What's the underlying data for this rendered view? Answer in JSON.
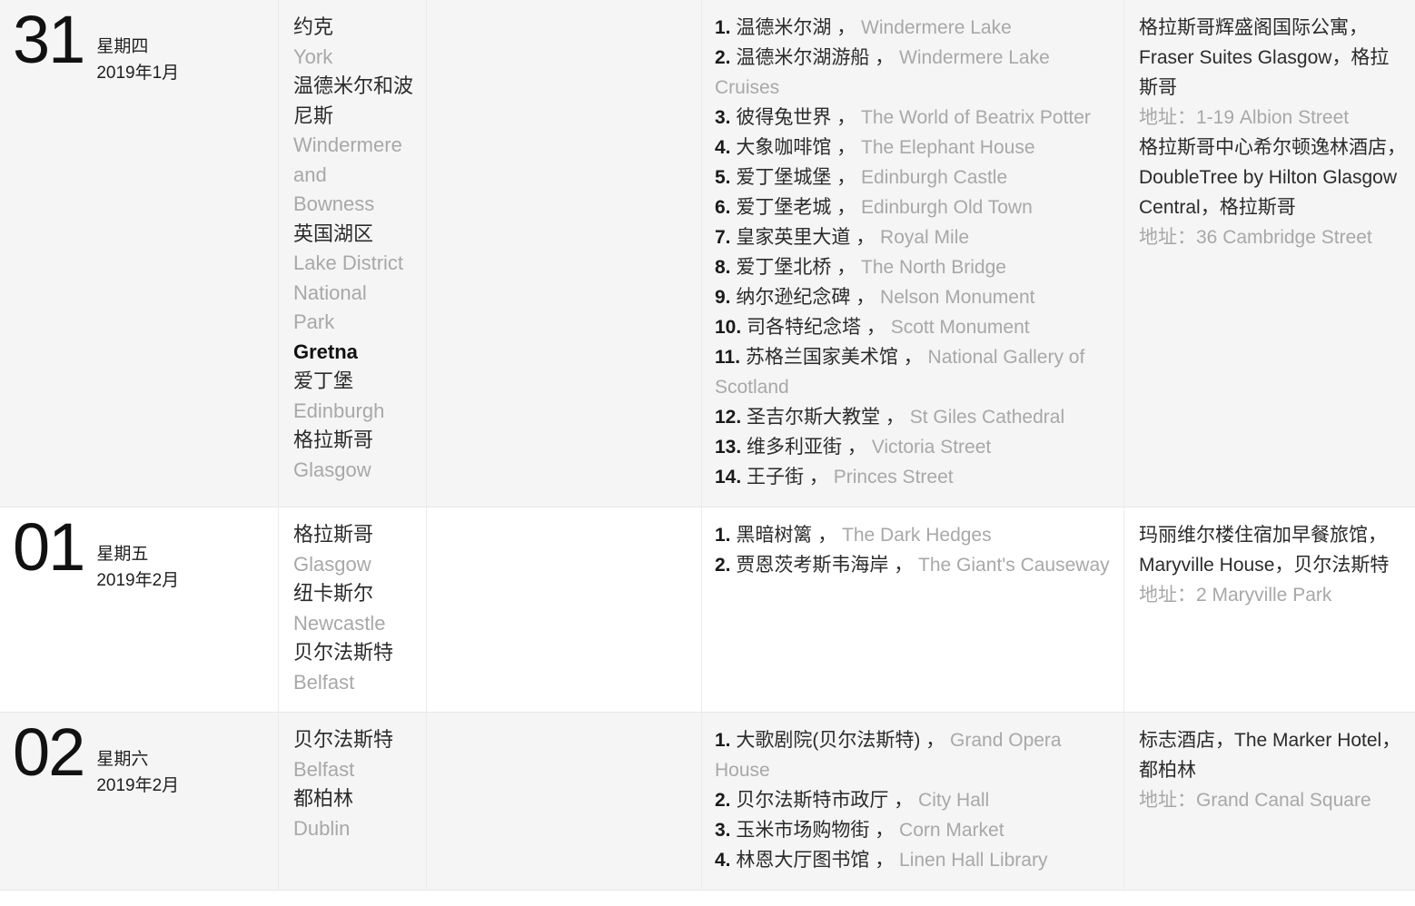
{
  "meta": {
    "view": "travel-itinerary-table",
    "colors": {
      "text_primary": "#2b2b2b",
      "text_secondary": "#a8a8a8",
      "row_shaded_bg": "#f5f5f5",
      "row_plain_bg": "#ffffff",
      "grid_line": "#e6e6e6"
    },
    "separator": "，",
    "address_label": "地址："
  },
  "rows": [
    {
      "shaded": true,
      "date": {
        "day": "31",
        "weekday": "星期四",
        "month_year": "2019年1月"
      },
      "cities": [
        {
          "zh": "约克",
          "en": "York"
        },
        {
          "zh": "温德米尔和波尼斯",
          "en": "Windermere and Bowness"
        },
        {
          "zh": "英国湖区",
          "en": "Lake District National Park"
        },
        {
          "zh": "",
          "en": "Gretna"
        },
        {
          "zh": "爱丁堡",
          "en": "Edinburgh"
        },
        {
          "zh": "格拉斯哥",
          "en": "Glasgow"
        }
      ],
      "transit": [],
      "sights": [
        {
          "n": "1.",
          "zh": "温德米尔湖",
          "en": "Windermere Lake"
        },
        {
          "n": "2.",
          "zh": "温德米尔湖游船",
          "en": "Windermere Lake Cruises"
        },
        {
          "n": "3.",
          "zh": "彼得兔世界",
          "en": "The World of Beatrix Potter"
        },
        {
          "n": "4.",
          "zh": "大象咖啡馆",
          "en": "The Elephant House"
        },
        {
          "n": "5.",
          "zh": "爱丁堡城堡",
          "en": "Edinburgh Castle"
        },
        {
          "n": "6.",
          "zh": "爱丁堡老城",
          "en": "Edinburgh Old Town"
        },
        {
          "n": "7.",
          "zh": "皇家英里大道",
          "en": "Royal Mile"
        },
        {
          "n": "8.",
          "zh": "爱丁堡北桥",
          "en": "The North Bridge"
        },
        {
          "n": "9.",
          "zh": "纳尔逊纪念碑",
          "en": "Nelson Monument"
        },
        {
          "n": "10.",
          "zh": "司各特纪念塔",
          "en": "Scott Monument"
        },
        {
          "n": "11.",
          "zh": "苏格兰国家美术馆",
          "en": "National Gallery of Scotland"
        },
        {
          "n": "12.",
          "zh": "圣吉尔斯大教堂",
          "en": "St Giles Cathedral"
        },
        {
          "n": "13.",
          "zh": "维多利亚街",
          "en": "Victoria Street"
        },
        {
          "n": "14.",
          "zh": "王子街",
          "en": "Princes Street"
        }
      ],
      "hotels": [
        {
          "zh": "格拉斯哥辉盛阁国际公寓",
          "en": "Fraser Suites Glasgow",
          "city": "格拉斯哥",
          "address": "1-19 Albion Street"
        },
        {
          "zh": "格拉斯哥中心希尔顿逸林酒店",
          "en": "DoubleTree by Hilton Glasgow Central",
          "city": "格拉斯哥",
          "address": "36 Cambridge Street"
        }
      ]
    },
    {
      "shaded": false,
      "date": {
        "day": "01",
        "weekday": "星期五",
        "month_year": "2019年2月"
      },
      "cities": [
        {
          "zh": "格拉斯哥",
          "en": "Glasgow"
        },
        {
          "zh": "纽卡斯尔",
          "en": "Newcastle"
        },
        {
          "zh": "贝尔法斯特",
          "en": "Belfast"
        }
      ],
      "transit": [],
      "sights": [
        {
          "n": "1.",
          "zh": "黑暗树篱",
          "en": "The Dark Hedges"
        },
        {
          "n": "2.",
          "zh": "贾恩茨考斯韦海岸",
          "en": "The Giant's Causeway"
        }
      ],
      "hotels": [
        {
          "zh": "玛丽维尔楼住宿加早餐旅馆",
          "en": "Maryville House",
          "city": "贝尔法斯特",
          "address": "2 Maryville Park"
        }
      ]
    },
    {
      "shaded": true,
      "date": {
        "day": "02",
        "weekday": "星期六",
        "month_year": "2019年2月"
      },
      "cities": [
        {
          "zh": "贝尔法斯特",
          "en": "Belfast"
        },
        {
          "zh": "都柏林",
          "en": "Dublin"
        }
      ],
      "transit": [],
      "sights": [
        {
          "n": "1.",
          "zh": "大歌剧院(贝尔法斯特)",
          "en": "Grand Opera House"
        },
        {
          "n": "2.",
          "zh": "贝尔法斯特市政厅",
          "en": "City Hall"
        },
        {
          "n": "3.",
          "zh": "玉米市场购物街",
          "en": "Corn Market"
        },
        {
          "n": "4.",
          "zh": "林恩大厅图书馆",
          "en": "Linen Hall Library"
        }
      ],
      "hotels": [
        {
          "zh": "标志酒店",
          "en": "The Marker Hotel",
          "city": "都柏林",
          "address": "Grand Canal Square"
        }
      ]
    }
  ]
}
